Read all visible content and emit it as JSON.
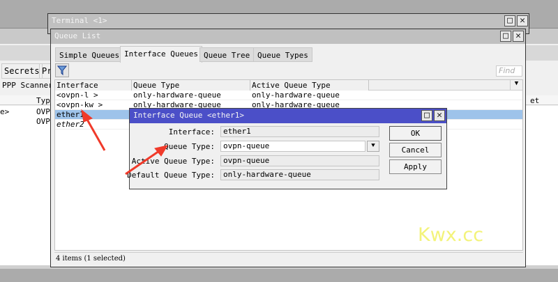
{
  "background": {
    "tabs": [
      "Secrets",
      "Pr"
    ],
    "toolbar_label": "PPP Scanner",
    "col_type": "Typ",
    "rows": [
      {
        "name": "e>",
        "type": "OVP"
      },
      {
        "name": "",
        "type": "OVP"
      }
    ],
    "right_col": "et (p/s)"
  },
  "terminal": {
    "title": "Terminal <1>"
  },
  "queue_list": {
    "title": "Queue List",
    "tabs": [
      "Simple Queues",
      "Interface Queues",
      "Queue Tree",
      "Queue Types"
    ],
    "active_tab": "Interface Queues",
    "find_placeholder": "Find",
    "columns": [
      "Interface",
      "Queue Type",
      "Active Queue Type"
    ],
    "rows": [
      {
        "interface": "<ovpn-l         >",
        "queue_type": "only-hardware-queue",
        "active": "only-hardware-queue"
      },
      {
        "interface": "<ovpn-kw        >",
        "queue_type": "only-hardware-queue",
        "active": "only-hardware-queue"
      },
      {
        "interface": "ether1",
        "queue_type": "",
        "active": "",
        "selected": true
      },
      {
        "interface": "ether2",
        "queue_type": "",
        "active": ""
      }
    ],
    "status": "4 items (1 selected)"
  },
  "dialog": {
    "title": "Interface Queue <ether1>",
    "fields": [
      {
        "label": "Interface:",
        "value": "ether1"
      },
      {
        "label": "Queue Type:",
        "value": "ovpn-queue"
      },
      {
        "label": "Active Queue Type:",
        "value": "ovpn-queue"
      },
      {
        "label": "Default Queue Type:",
        "value": "only-hardware-queue"
      }
    ],
    "buttons": {
      "ok": "OK",
      "cancel": "Cancel",
      "apply": "Apply"
    }
  },
  "watermark": "Kwx.cc",
  "colors": {
    "dialog_title": "#4b4fc8",
    "selection": "#9ec3ea",
    "arrow": "#f03a2a",
    "watermark": "#f3f37a"
  }
}
